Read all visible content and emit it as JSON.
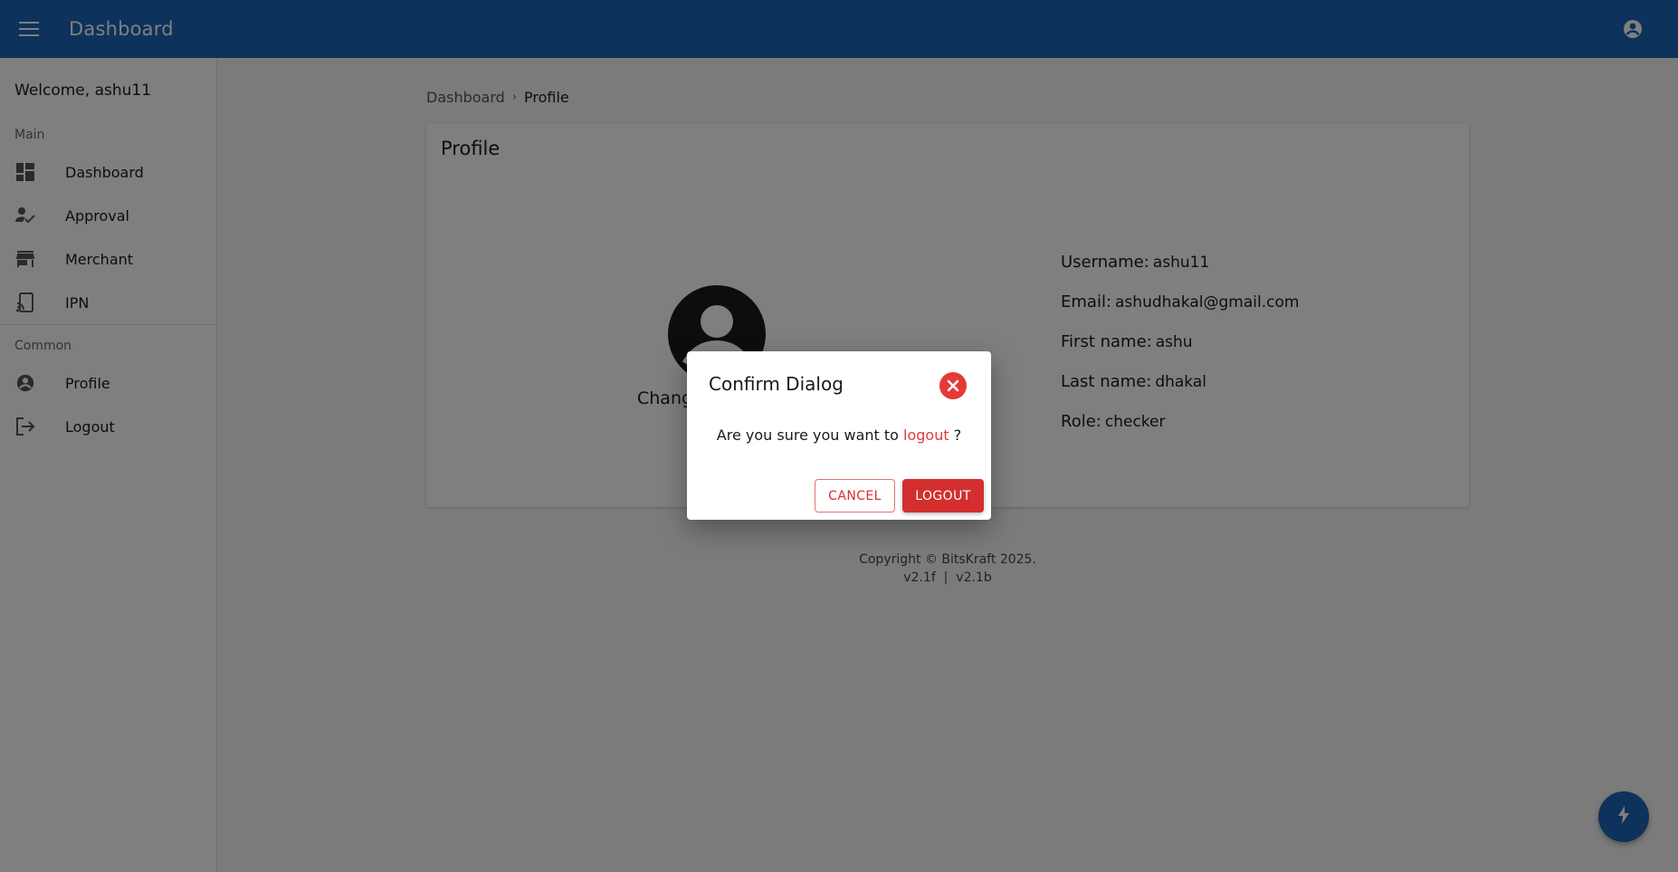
{
  "header": {
    "title": "Dashboard",
    "menu_icon": "menu-icon",
    "account_icon": "account-circle-icon"
  },
  "sidebar": {
    "welcome": "Welcome, ashu11",
    "sections": [
      {
        "label": "Main",
        "items": [
          {
            "label": "Dashboard",
            "icon": "dashboard-icon"
          },
          {
            "label": "Approval",
            "icon": "approval-icon"
          },
          {
            "label": "Merchant",
            "icon": "store-icon"
          },
          {
            "label": "IPN",
            "icon": "cast-icon"
          }
        ]
      },
      {
        "label": "Common",
        "items": [
          {
            "label": "Profile",
            "icon": "account-circle-icon"
          },
          {
            "label": "Logout",
            "icon": "logout-icon"
          }
        ]
      }
    ]
  },
  "breadcrumb": {
    "parent": "Dashboard",
    "separator": "›",
    "current": "Profile"
  },
  "profile": {
    "title": "Profile",
    "change_text": "Chang",
    "fields": [
      {
        "label": "Username:",
        "value": "ashu11"
      },
      {
        "label": "Email:",
        "value": "ashudhakal@gmail.com"
      },
      {
        "label": "First name:",
        "value": "ashu"
      },
      {
        "label": "Last name:",
        "value": "dhakal"
      },
      {
        "label": "Role:",
        "value": "checker"
      }
    ]
  },
  "footer": {
    "copyright": "Copyright © BitsKraft 2025.",
    "version": "v2.1f  |  v2.1b"
  },
  "fab": {
    "icon": "bolt-icon"
  },
  "dialog": {
    "title": "Confirm Dialog",
    "message_before": "Are you sure you want to ",
    "message_highlight": "logout",
    "message_after": " ?",
    "cancel_label": "CANCEL",
    "confirm_label": "LOGOUT"
  },
  "colors": {
    "primary": "#1a65b8",
    "danger": "#d32f2f",
    "close_red": "#e53935"
  }
}
